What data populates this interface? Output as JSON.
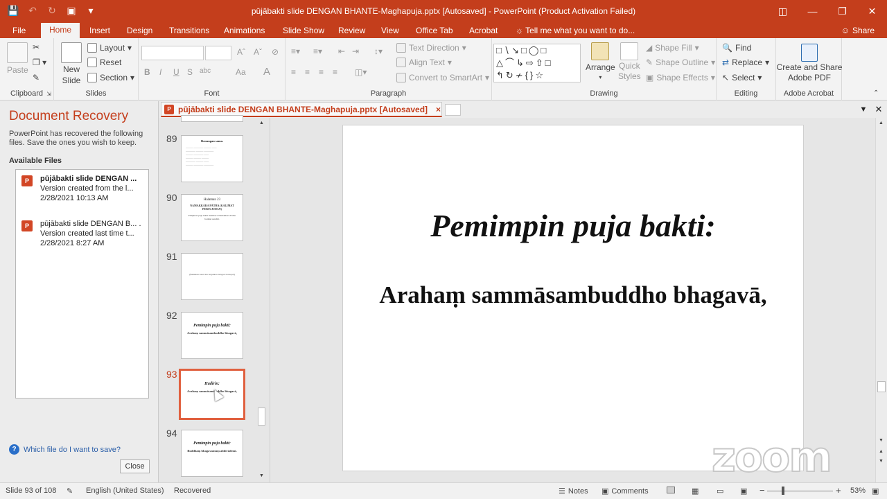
{
  "window": {
    "title": "pūjābakti slide DENGAN BHANTE-Maghapuja.pptx [Autosaved] - PowerPoint (Product Activation Failed)"
  },
  "ribbon_tabs": {
    "file": "File",
    "home": "Home",
    "insert": "Insert",
    "design": "Design",
    "transitions": "Transitions",
    "animations": "Animations",
    "slideshow": "Slide Show",
    "review": "Review",
    "view": "View",
    "officetab": "Office Tab",
    "acrobat": "Acrobat",
    "tellme": "Tell me what you want to do...",
    "share": "Share"
  },
  "ribbon": {
    "clipboard": {
      "paste": "Paste",
      "label": "Clipboard"
    },
    "slides": {
      "new_slide_1": "New",
      "new_slide_2": "Slide",
      "layout": "Layout",
      "reset": "Reset",
      "section": "Section",
      "label": "Slides"
    },
    "font": {
      "bold": "B",
      "italic": "I",
      "underline": "U",
      "strike": "S",
      "spacing": "abc",
      "case": "Aa",
      "label": "Font"
    },
    "paragraph": {
      "text_direction": "Text Direction",
      "align_text": "Align Text",
      "convert_smartart": "Convert to SmartArt",
      "label": "Paragraph"
    },
    "drawing": {
      "arrange": "Arrange",
      "quick_styles_1": "Quick",
      "quick_styles_2": "Styles",
      "shape_fill": "Shape Fill",
      "shape_outline": "Shape Outline",
      "shape_effects": "Shape Effects",
      "label": "Drawing"
    },
    "editing": {
      "find": "Find",
      "replace": "Replace",
      "select": "Select",
      "label": "Editing"
    },
    "acrobat": {
      "create_share_1": "Create and Share",
      "create_share_2": "Adobe PDF",
      "label": "Adobe Acrobat"
    }
  },
  "recovery": {
    "title": "Document Recovery",
    "description": "PowerPoint has recovered the following files.  Save the ones you wish to keep.",
    "available_files": "Available Files",
    "files": [
      {
        "name": "pūjābakti slide DENGAN ...",
        "detail": "Version created from the l...",
        "time": "2/28/2021 10:13 AM"
      },
      {
        "name": "pūjābakti slide DENGAN B... .",
        "detail": "Version created last time t...",
        "time": "2/28/2021 8:27 AM"
      }
    ],
    "help_link": "Which file do I want to save?",
    "close": "Close"
  },
  "doc_tab": {
    "label": "pūjābakti slide DENGAN BHANTE-Maghapuja.pptx [Autosaved]",
    "close": "×"
  },
  "thumbnails": [
    {
      "num": "89",
      "title": "Renungan sama."
    },
    {
      "num": "90",
      "header": "Halaman 23",
      "title": "NAMAKKĀRA PĀTHA (KALIMAT PERSUJUDAN)",
      "body": "Pimpinan puja bakti membaca Namakkara Patha berikut sendiri."
    },
    {
      "num": "91",
      "body": "(Balikkan kaki dan lanjutkan dengan bersujud)"
    },
    {
      "num": "92",
      "title": "Pemimpin puja bakti:",
      "body": "Arahaṃ sammāsambuddho bhagavā,"
    },
    {
      "num": "93",
      "title": "Hadirin:",
      "body": "Arahaṃ sammāsambuddho bhagavā,"
    },
    {
      "num": "94",
      "title": "Pemimpin puja bakti:",
      "body": "Buddhaṃ bhagavantaṃ abhivādemi."
    }
  ],
  "slide": {
    "title": "Pemimpin puja bakti:",
    "body": "Arahaṃ sammāsambuddho bhagavā,"
  },
  "watermark": "zoom",
  "status": {
    "slide_count": "Slide 93 of 108",
    "language": "English (United States)",
    "recovered": "Recovered",
    "notes": "Notes",
    "comments": "Comments",
    "zoom_minus": "−",
    "zoom_plus": "+",
    "zoom_level": "53%"
  }
}
